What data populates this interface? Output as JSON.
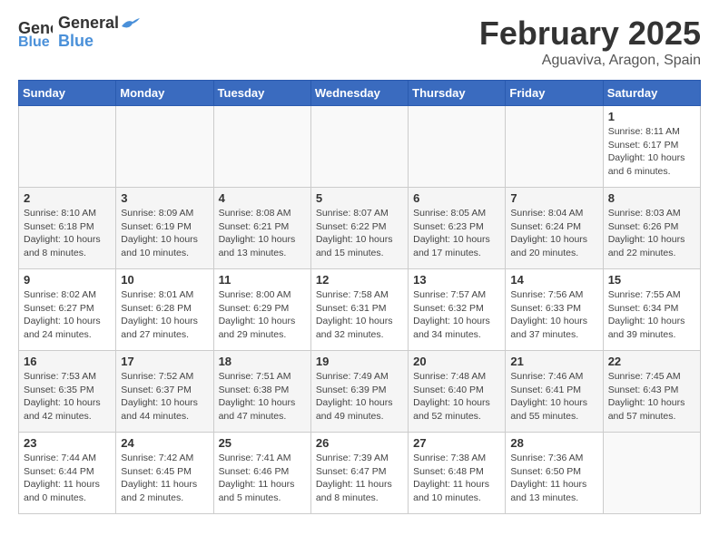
{
  "header": {
    "logo_line1": "General",
    "logo_line2": "Blue",
    "month": "February 2025",
    "location": "Aguaviva, Aragon, Spain"
  },
  "weekdays": [
    "Sunday",
    "Monday",
    "Tuesday",
    "Wednesday",
    "Thursday",
    "Friday",
    "Saturday"
  ],
  "weeks": [
    [
      {
        "day": "",
        "info": ""
      },
      {
        "day": "",
        "info": ""
      },
      {
        "day": "",
        "info": ""
      },
      {
        "day": "",
        "info": ""
      },
      {
        "day": "",
        "info": ""
      },
      {
        "day": "",
        "info": ""
      },
      {
        "day": "1",
        "info": "Sunrise: 8:11 AM\nSunset: 6:17 PM\nDaylight: 10 hours\nand 6 minutes."
      }
    ],
    [
      {
        "day": "2",
        "info": "Sunrise: 8:10 AM\nSunset: 6:18 PM\nDaylight: 10 hours\nand 8 minutes."
      },
      {
        "day": "3",
        "info": "Sunrise: 8:09 AM\nSunset: 6:19 PM\nDaylight: 10 hours\nand 10 minutes."
      },
      {
        "day": "4",
        "info": "Sunrise: 8:08 AM\nSunset: 6:21 PM\nDaylight: 10 hours\nand 13 minutes."
      },
      {
        "day": "5",
        "info": "Sunrise: 8:07 AM\nSunset: 6:22 PM\nDaylight: 10 hours\nand 15 minutes."
      },
      {
        "day": "6",
        "info": "Sunrise: 8:05 AM\nSunset: 6:23 PM\nDaylight: 10 hours\nand 17 minutes."
      },
      {
        "day": "7",
        "info": "Sunrise: 8:04 AM\nSunset: 6:24 PM\nDaylight: 10 hours\nand 20 minutes."
      },
      {
        "day": "8",
        "info": "Sunrise: 8:03 AM\nSunset: 6:26 PM\nDaylight: 10 hours\nand 22 minutes."
      }
    ],
    [
      {
        "day": "9",
        "info": "Sunrise: 8:02 AM\nSunset: 6:27 PM\nDaylight: 10 hours\nand 24 minutes."
      },
      {
        "day": "10",
        "info": "Sunrise: 8:01 AM\nSunset: 6:28 PM\nDaylight: 10 hours\nand 27 minutes."
      },
      {
        "day": "11",
        "info": "Sunrise: 8:00 AM\nSunset: 6:29 PM\nDaylight: 10 hours\nand 29 minutes."
      },
      {
        "day": "12",
        "info": "Sunrise: 7:58 AM\nSunset: 6:31 PM\nDaylight: 10 hours\nand 32 minutes."
      },
      {
        "day": "13",
        "info": "Sunrise: 7:57 AM\nSunset: 6:32 PM\nDaylight: 10 hours\nand 34 minutes."
      },
      {
        "day": "14",
        "info": "Sunrise: 7:56 AM\nSunset: 6:33 PM\nDaylight: 10 hours\nand 37 minutes."
      },
      {
        "day": "15",
        "info": "Sunrise: 7:55 AM\nSunset: 6:34 PM\nDaylight: 10 hours\nand 39 minutes."
      }
    ],
    [
      {
        "day": "16",
        "info": "Sunrise: 7:53 AM\nSunset: 6:35 PM\nDaylight: 10 hours\nand 42 minutes."
      },
      {
        "day": "17",
        "info": "Sunrise: 7:52 AM\nSunset: 6:37 PM\nDaylight: 10 hours\nand 44 minutes."
      },
      {
        "day": "18",
        "info": "Sunrise: 7:51 AM\nSunset: 6:38 PM\nDaylight: 10 hours\nand 47 minutes."
      },
      {
        "day": "19",
        "info": "Sunrise: 7:49 AM\nSunset: 6:39 PM\nDaylight: 10 hours\nand 49 minutes."
      },
      {
        "day": "20",
        "info": "Sunrise: 7:48 AM\nSunset: 6:40 PM\nDaylight: 10 hours\nand 52 minutes."
      },
      {
        "day": "21",
        "info": "Sunrise: 7:46 AM\nSunset: 6:41 PM\nDaylight: 10 hours\nand 55 minutes."
      },
      {
        "day": "22",
        "info": "Sunrise: 7:45 AM\nSunset: 6:43 PM\nDaylight: 10 hours\nand 57 minutes."
      }
    ],
    [
      {
        "day": "23",
        "info": "Sunrise: 7:44 AM\nSunset: 6:44 PM\nDaylight: 11 hours\nand 0 minutes."
      },
      {
        "day": "24",
        "info": "Sunrise: 7:42 AM\nSunset: 6:45 PM\nDaylight: 11 hours\nand 2 minutes."
      },
      {
        "day": "25",
        "info": "Sunrise: 7:41 AM\nSunset: 6:46 PM\nDaylight: 11 hours\nand 5 minutes."
      },
      {
        "day": "26",
        "info": "Sunrise: 7:39 AM\nSunset: 6:47 PM\nDaylight: 11 hours\nand 8 minutes."
      },
      {
        "day": "27",
        "info": "Sunrise: 7:38 AM\nSunset: 6:48 PM\nDaylight: 11 hours\nand 10 minutes."
      },
      {
        "day": "28",
        "info": "Sunrise: 7:36 AM\nSunset: 6:50 PM\nDaylight: 11 hours\nand 13 minutes."
      },
      {
        "day": "",
        "info": ""
      }
    ]
  ]
}
